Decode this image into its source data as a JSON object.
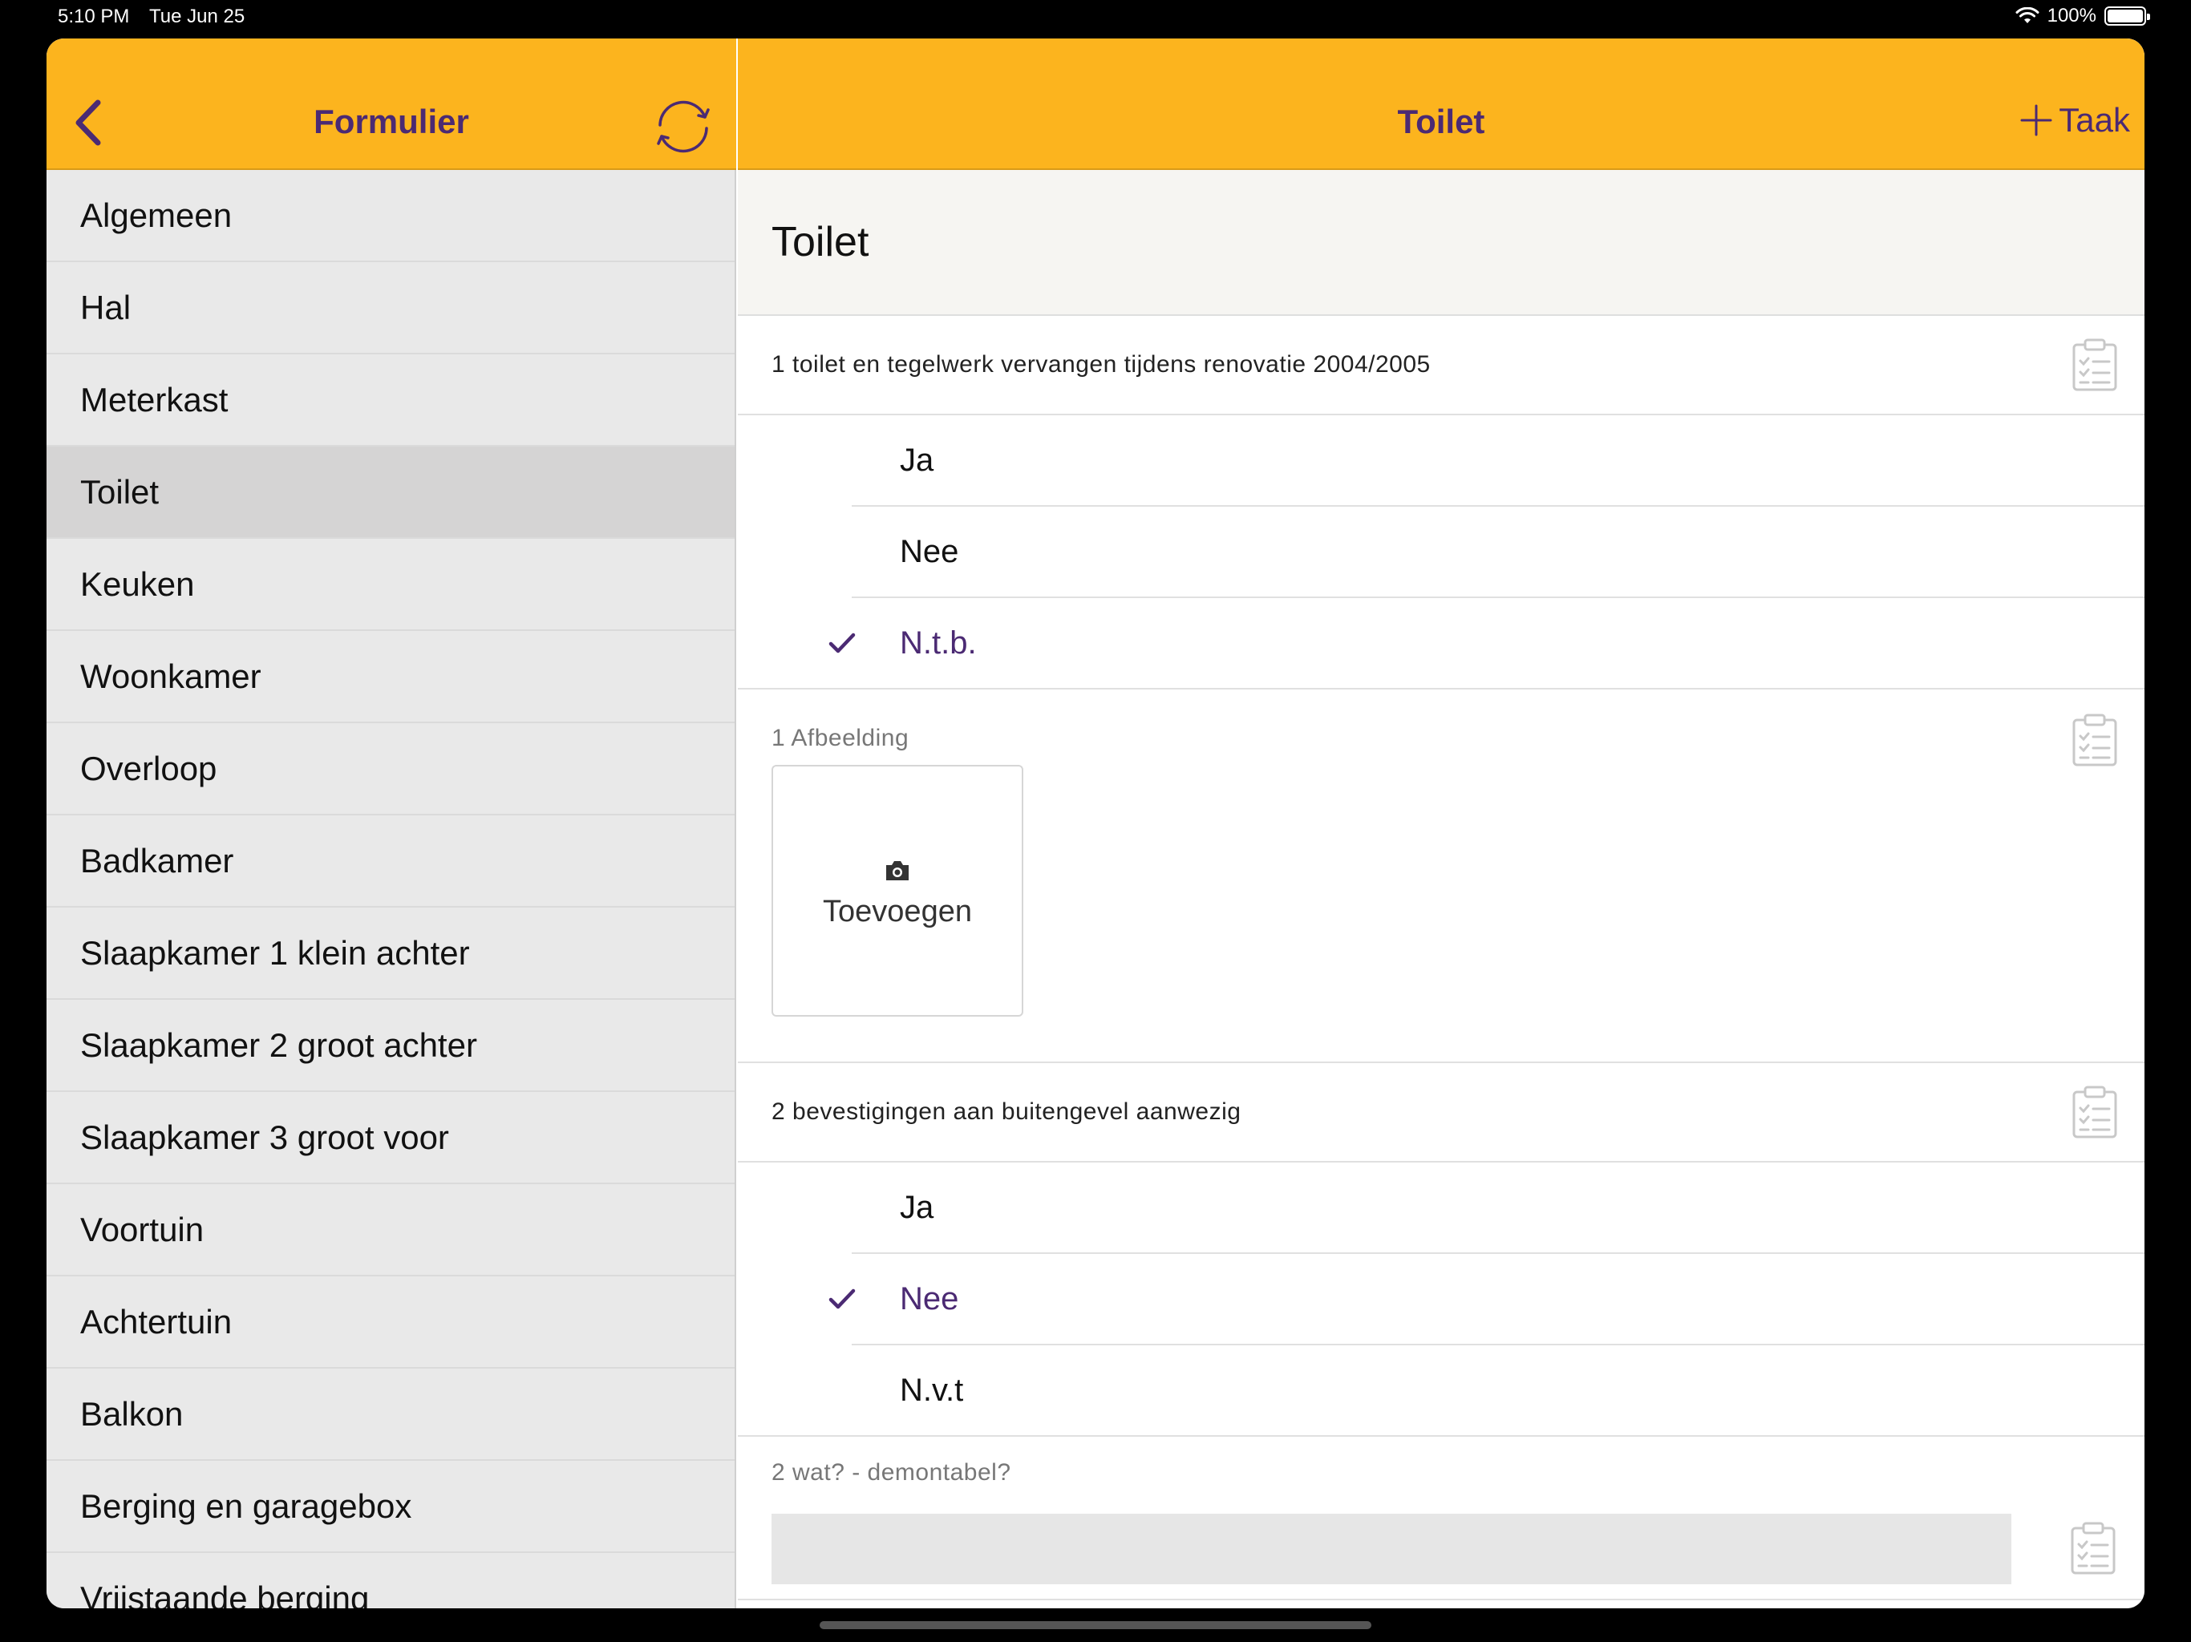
{
  "status_bar": {
    "time": "5:10 PM",
    "date": "Tue Jun 25",
    "battery": "100%"
  },
  "sidebar": {
    "title": "Formulier",
    "selected_index": 3,
    "items": [
      "Algemeen",
      "Hal",
      "Meterkast",
      "Toilet",
      "Keuken",
      "Woonkamer",
      "Overloop",
      "Badkamer",
      "Slaapkamer 1 klein achter",
      "Slaapkamer 2 groot achter",
      "Slaapkamer 3 groot voor",
      "Voortuin",
      "Achtertuin",
      "Balkon",
      "Berging en garagebox",
      "Vrijstaande berging"
    ]
  },
  "main": {
    "title": "Toilet",
    "add_task_label": "Taak",
    "section_title": "Toilet",
    "q1": {
      "text": "1 toilet en tegelwerk vervangen tijdens renovatie 2004/2005",
      "options": [
        "Ja",
        "Nee",
        "N.t.b."
      ],
      "selected": "N.t.b."
    },
    "images": {
      "text": "1 Afbeelding",
      "add_label": "Toevoegen"
    },
    "q2": {
      "text": "2 bevestigingen aan buitengevel aanwezig",
      "options": [
        "Ja",
        "Nee",
        "N.v.t"
      ],
      "selected": "Nee"
    },
    "q3": {
      "text": "2 wat? - demontabel?",
      "value": ""
    }
  },
  "colors": {
    "header": "#fcb41e",
    "accent": "#4b2a73",
    "sidebar_bg": "#e9e9e9",
    "selected_bg": "#d5d4d4"
  }
}
